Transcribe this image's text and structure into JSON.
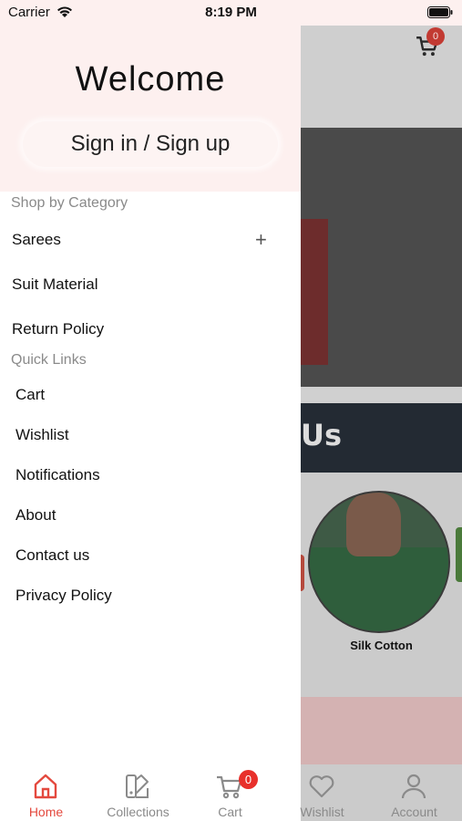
{
  "status_bar": {
    "carrier": "Carrier",
    "time": "8:19 PM"
  },
  "drawer": {
    "welcome": "Welcome",
    "sign_in": "Sign in / Sign up",
    "shop_by_category": "Shop by Category",
    "categories": [
      {
        "label": "Sarees",
        "expand": "+"
      },
      {
        "label": "Suit Material"
      },
      {
        "label": "Return Policy"
      }
    ],
    "quick_links_title": "Quick Links",
    "quick_links": [
      "Cart",
      "Wishlist",
      "Notifications",
      "About",
      "Contact us",
      "Privacy Policy"
    ]
  },
  "background": {
    "cart_badge": "0",
    "section_heading": "Us",
    "collection_item": "Silk Cotton"
  },
  "tab_bar": {
    "items": [
      {
        "label": "Home",
        "icon": "home-icon",
        "active": true
      },
      {
        "label": "Collections",
        "icon": "collections-icon"
      },
      {
        "label": "Cart",
        "icon": "cart-icon",
        "badge": "0"
      },
      {
        "label": "Wishlist",
        "icon": "heart-icon"
      },
      {
        "label": "Account",
        "icon": "account-icon"
      }
    ]
  },
  "colors": {
    "accent": "#e4493e",
    "header_bg": "#fdf0ef",
    "badge": "#e8302b"
  }
}
